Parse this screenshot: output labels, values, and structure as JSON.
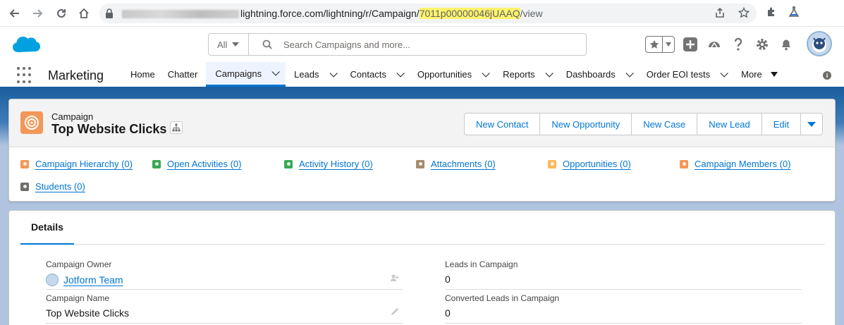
{
  "browser": {
    "url_host": "lightning.force.com/lightning/r/Campaign/",
    "url_id": "7011p00000046jUAAQ",
    "url_tail": "/view"
  },
  "header": {
    "search_scope": "All",
    "search_placeholder": "Search Campaigns and more..."
  },
  "nav": {
    "app_name": "Marketing",
    "items": [
      {
        "label": "Home",
        "dropdown": false
      },
      {
        "label": "Chatter",
        "dropdown": false
      },
      {
        "label": "Campaigns",
        "dropdown": true,
        "active": true
      },
      {
        "label": "Leads",
        "dropdown": true
      },
      {
        "label": "Contacts",
        "dropdown": true
      },
      {
        "label": "Opportunities",
        "dropdown": true
      },
      {
        "label": "Reports",
        "dropdown": true
      },
      {
        "label": "Dashboards",
        "dropdown": true
      },
      {
        "label": "Order EOI tests",
        "dropdown": true
      }
    ],
    "more_label": "More"
  },
  "record": {
    "object_type": "Campaign",
    "title": "Top Website Clicks",
    "actions": [
      "New Contact",
      "New Opportunity",
      "New Case",
      "New Lead",
      "Edit"
    ]
  },
  "related": [
    {
      "label": "Campaign Hierarchy (0)",
      "color": "#f49756"
    },
    {
      "label": "Open Activities (0)",
      "color": "#3ba755"
    },
    {
      "label": "Activity History (0)",
      "color": "#3ba755"
    },
    {
      "label": "Attachments (0)",
      "color": "#a38b6a"
    },
    {
      "label": "Opportunities (0)",
      "color": "#fcb95b"
    },
    {
      "label": "Campaign Members (0)",
      "color": "#f49756"
    },
    {
      "label": "Students (0)",
      "color": "#706e6b"
    }
  ],
  "details": {
    "tab_label": "Details",
    "fields": {
      "owner_label": "Campaign Owner",
      "owner_value": "Jotform Team",
      "name_label": "Campaign Name",
      "name_value": "Top Website Clicks",
      "leads_label": "Leads in Campaign",
      "leads_value": "0",
      "converted_label": "Converted Leads in Campaign",
      "converted_value": "0"
    }
  }
}
